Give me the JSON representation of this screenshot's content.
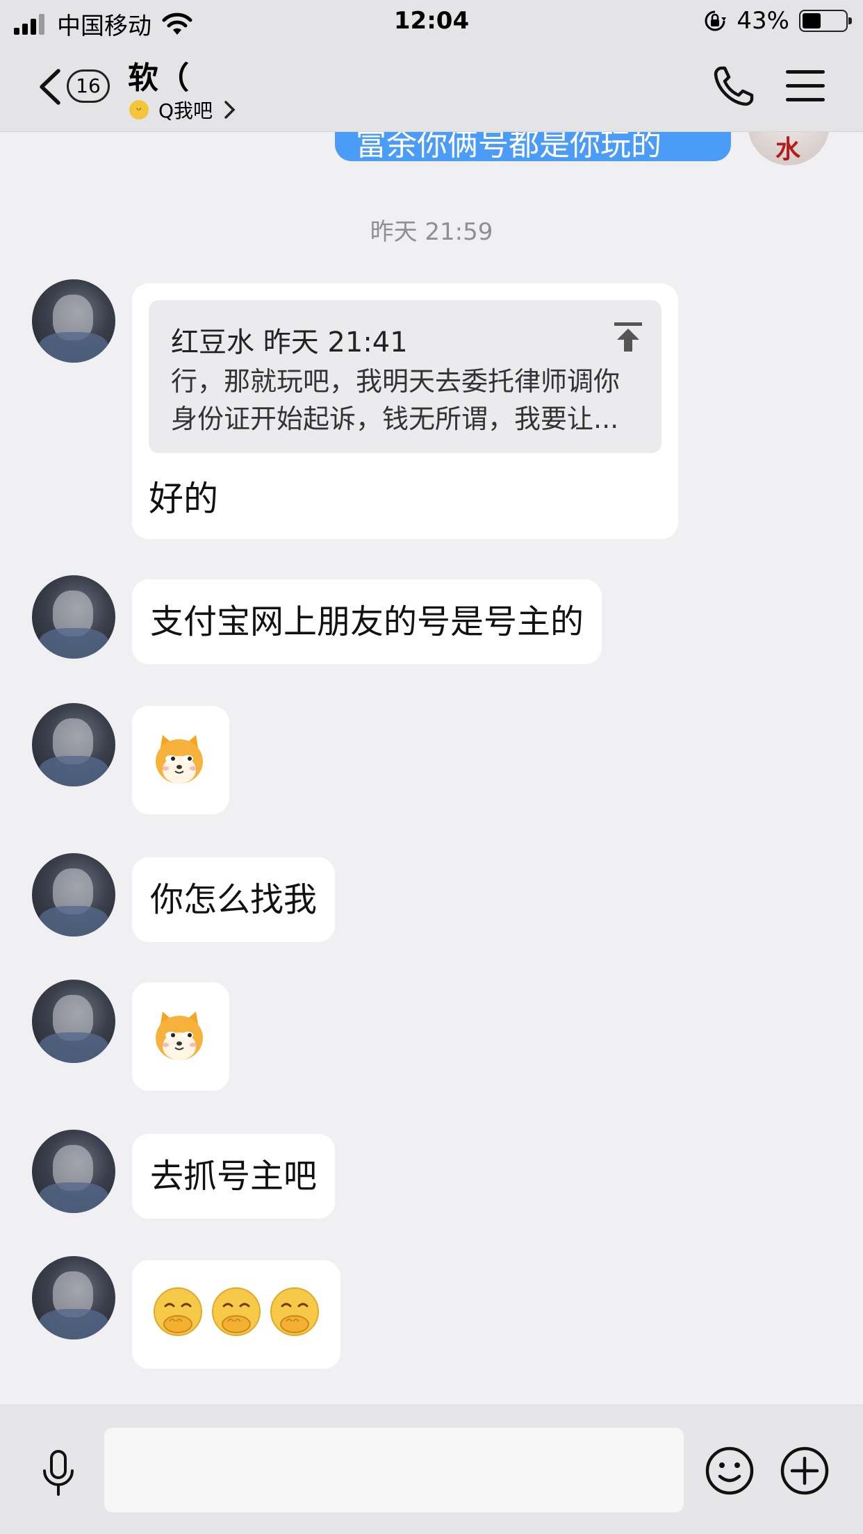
{
  "status_bar": {
    "carrier": "中国移动",
    "time": "12:04",
    "battery": "43%",
    "battery_level": 0.43
  },
  "header": {
    "unread_count": "16",
    "contact_name": "软（",
    "sub_label": "Q我吧"
  },
  "chat": {
    "outgoing_partial_text": "富余你俩号都是你玩的",
    "my_avatar_text": "水",
    "timestamp": "昨天 21:59",
    "quote": {
      "header": "红豆水 昨天 21:41",
      "body": "行，那就玩吧，我明天去委托律师调你身份证开始起诉，钱无所谓，我要让...",
      "reply": "好的"
    },
    "messages": [
      "支付宝网上朋友的号是号主的",
      "你怎么找我",
      "去抓号主吧"
    ]
  },
  "input": {
    "placeholder": ""
  },
  "colors": {
    "outgoing_bubble": "#4a9cf7",
    "incoming_bubble": "#ffffff",
    "background": "#f0f0f2",
    "bar": "#e4e4e6"
  }
}
